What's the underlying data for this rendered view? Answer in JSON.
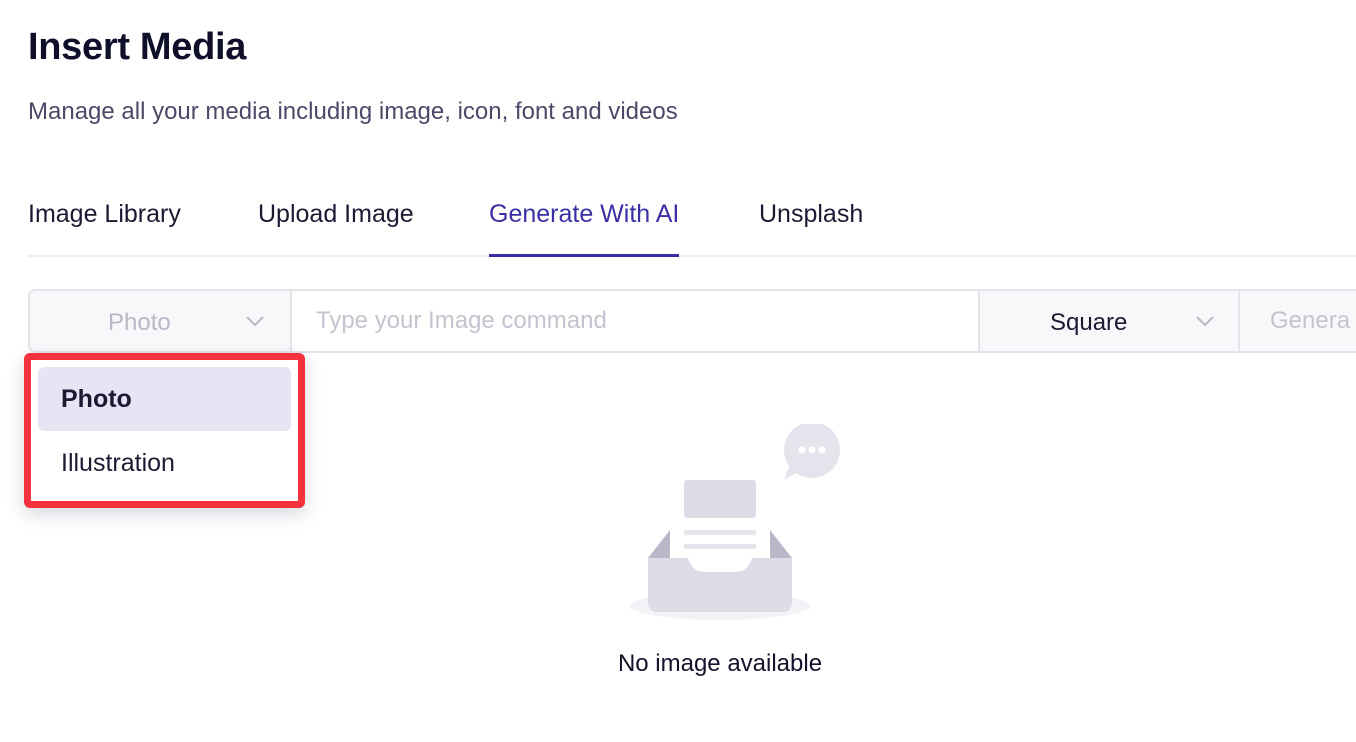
{
  "header": {
    "title": "Insert Media",
    "subtitle": "Manage all your media including image, icon, font and videos"
  },
  "tabs": [
    {
      "label": "Image Library",
      "active": false
    },
    {
      "label": "Upload Image",
      "active": false
    },
    {
      "label": "Generate With AI",
      "active": true
    },
    {
      "label": "Unsplash",
      "active": false
    }
  ],
  "toolbar": {
    "type_select_value": "Photo",
    "prompt_placeholder": "Type your Image command",
    "ratio_select_value": "Square",
    "generate_label": "Genera"
  },
  "dropdown": {
    "options": [
      {
        "label": "Photo",
        "selected": true
      },
      {
        "label": "Illustration",
        "selected": false
      }
    ],
    "highlight_color": "#f5313d"
  },
  "empty_state": {
    "message": "No image available",
    "icon": "empty-inbox-icon"
  },
  "colors": {
    "accent": "#3b2fa6",
    "selected_bg": "#e7e5f3"
  }
}
